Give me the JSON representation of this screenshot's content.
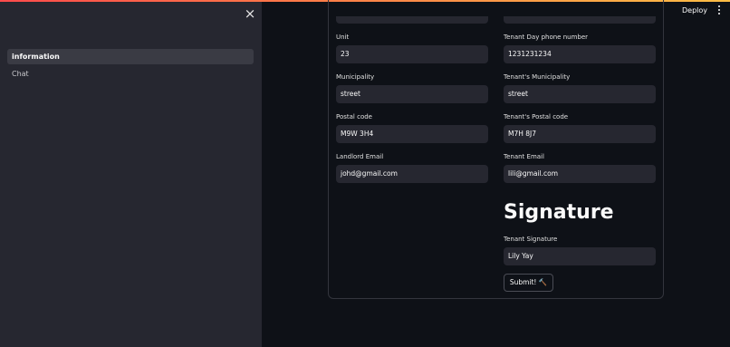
{
  "sidebar": {
    "close_icon": "×",
    "items": [
      {
        "label": "information",
        "active": true
      },
      {
        "label": "Chat",
        "active": false
      }
    ]
  },
  "header": {
    "deploy_label": "Deploy",
    "menu_icon": "vertical-dots"
  },
  "form": {
    "left": [
      {
        "label": "Unit",
        "value": "23"
      },
      {
        "label": "Municipality",
        "value": "street"
      },
      {
        "label": "Postal code",
        "value": "M9W 3H4"
      },
      {
        "label": "Landlord Email",
        "value": "johd@gmail.com"
      }
    ],
    "right": [
      {
        "label": "Tenant Day phone number",
        "value": "1231231234"
      },
      {
        "label": "Tenant's Municipality",
        "value": "street"
      },
      {
        "label": "Tenant's Postal code",
        "value": "M7H 8J7"
      },
      {
        "label": "Tenant Email",
        "value": "lili@gmail.com"
      }
    ],
    "signature": {
      "heading": "Signature",
      "label": "Tenant Signature",
      "value": "Lily Yay"
    },
    "submit_label": "Submit! 🔨"
  },
  "colors": {
    "sidebar_bg": "#262730",
    "main_bg": "#0e1117",
    "input_bg": "#262730",
    "accent_gradient_start": "#ff4b4b",
    "accent_gradient_end": "#ffbd45"
  }
}
